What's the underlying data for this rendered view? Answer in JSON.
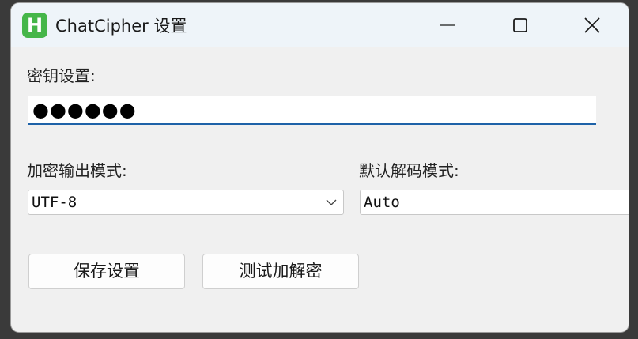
{
  "window": {
    "title": "ChatCipher 设置",
    "app_icon_letter": "H",
    "accent_color": "#45b649",
    "minimize_icon": "minimize-icon",
    "maximize_icon": "maximize-icon",
    "close_icon": "close-icon"
  },
  "key_section": {
    "label": "密钥设置:",
    "password_mask": "●●●●●●"
  },
  "encrypt_section": {
    "label": "加密输出模式:",
    "selected": "UTF-8"
  },
  "decrypt_section": {
    "label": "默认解码模式:",
    "selected": "Auto"
  },
  "buttons": {
    "save_label": "保存设置",
    "test_label": "测试加解密"
  }
}
